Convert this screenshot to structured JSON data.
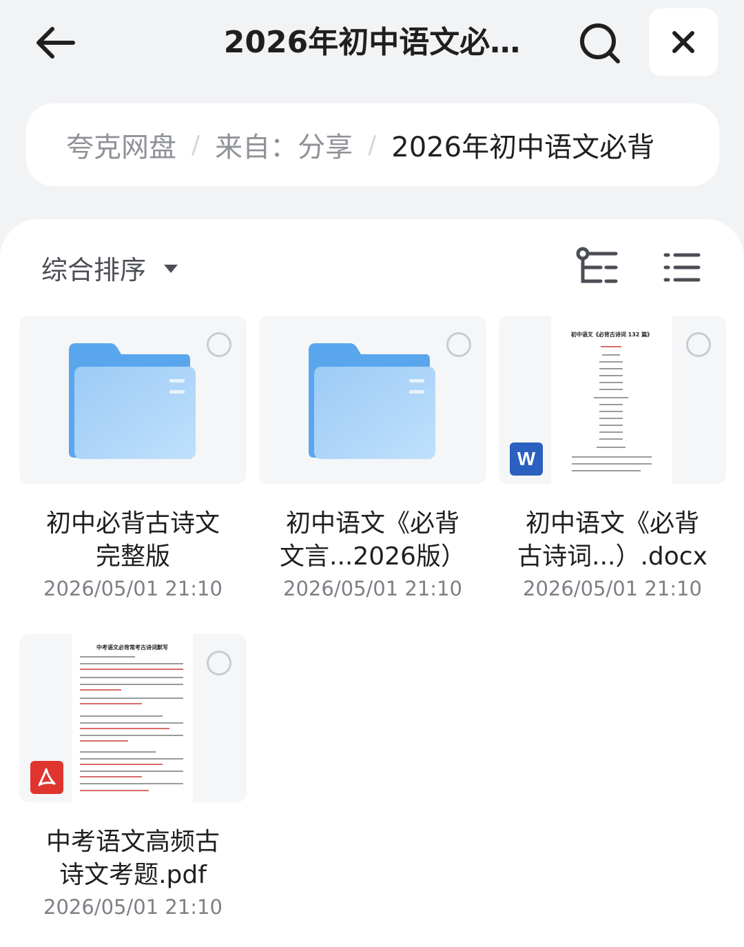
{
  "header": {
    "title": "2026年初中语文必…",
    "back_icon": "back-arrow-icon",
    "search_icon": "search-icon",
    "close_icon": "close-icon"
  },
  "breadcrumb": {
    "items": [
      "夸克网盘",
      "来自：分享",
      "2026年初中语文必背"
    ],
    "separator": "/"
  },
  "toolbar": {
    "sort_label": "综合排序",
    "tree_icon": "tree-view-icon",
    "list_icon": "list-view-icon"
  },
  "files": [
    {
      "name_line1": "初中必背古诗文",
      "name_line2": "完整版",
      "date": "2026/05/01 21:10",
      "type": "folder"
    },
    {
      "name_line1": "初中语文《必背",
      "name_line2": "文言...2026版）",
      "date": "2026/05/01 21:10",
      "type": "folder"
    },
    {
      "name_line1": "初中语文《必背",
      "name_line2": "古诗词...）.docx",
      "date": "2026/05/01 21:10",
      "type": "docx",
      "preview_title": "初中语文《必背古诗词 132 篇》",
      "badge": "W"
    },
    {
      "name_line1": "中考语文高频古",
      "name_line2": "诗文考题.pdf",
      "date": "2026/05/01 21:10",
      "type": "pdf",
      "preview_title": "中考语文必背常考古诗词默写"
    }
  ],
  "colors": {
    "folder": "#7fb9f2",
    "word_badge": "#2b5fc0",
    "pdf_badge": "#e0352f",
    "accent_text": "#1f1f1f"
  }
}
